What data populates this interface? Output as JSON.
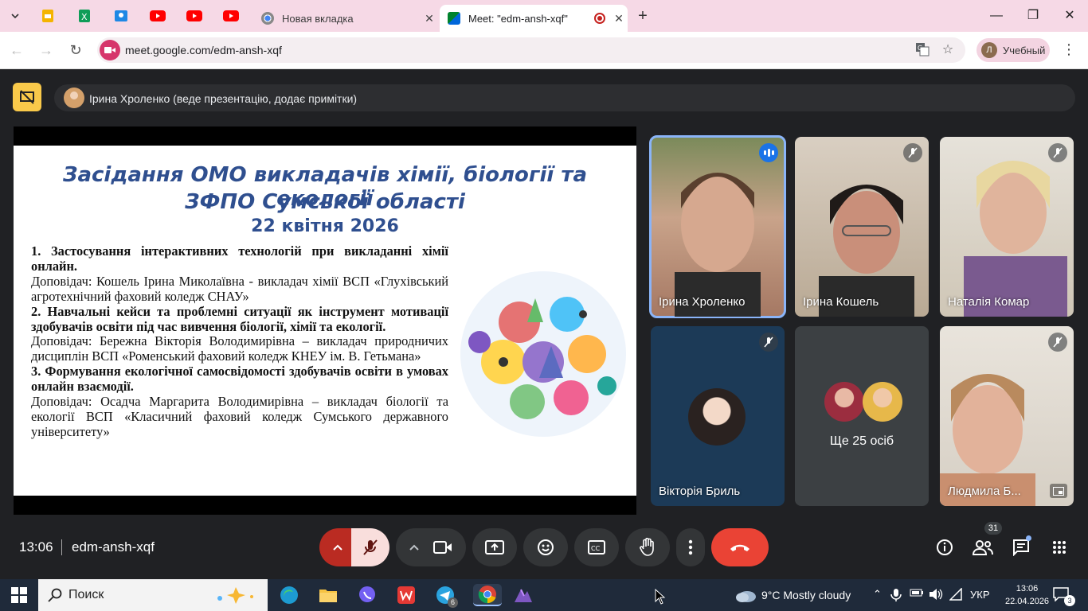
{
  "browser": {
    "tabs": [
      {
        "title": "Новая вкладка",
        "close": "✕"
      },
      {
        "title": "Meet: \"edm-ansh-xqf\"",
        "close": "✕"
      }
    ],
    "address": "meet.google.com/edm-ansh-xqf",
    "profile_initial": "Л",
    "profile_label": "Учебный"
  },
  "presenter_bar": {
    "text": "Ірина Хроленко (веде презентацію, додає примітки)"
  },
  "slide": {
    "title_line1": "Засідання ОМО викладачів хімії, біології та екології",
    "title_line2": "ЗФПО Сумської області",
    "date": "22 квітня 2026",
    "items": [
      {
        "heading": "1. Застосування інтерактивних технологій при викладанні хімії онлайн.",
        "speaker": "Доповідач: Кошель Ірина Миколаївна - викладач хімії ВСП «Глухівський агротехнічний фаховий коледж СНАУ»"
      },
      {
        "heading": "2. Навчальні кейси та проблемні ситуації як інструмент мотивації здобувачів освіти під час вивчення біології, хімії та екології.",
        "speaker": "Доповідач: Бережна Вікторія Володимирівна – викладач природничих дисциплін ВСП «Роменський фаховий коледж КНЕУ ім. В. Гетьмана»"
      },
      {
        "heading": "3. Формування екологічної самосвідомості здобувачів освіти в умовах онлайн взаємодії.",
        "speaker": "Доповідач: Осадча Маргарита Володимирівна – викладач біології та екології ВСП «Класичний фаховий коледж Сумського державного університету»"
      }
    ]
  },
  "participants": [
    {
      "name": "Ірина Хроленко",
      "state": "speaking"
    },
    {
      "name": "Ірина Кошель",
      "state": "muted"
    },
    {
      "name": "Наталія Комар",
      "state": "muted"
    },
    {
      "name": "Вікторія Бриль",
      "state": "muted"
    },
    {
      "name": "Ще 25 осіб",
      "state": "group"
    },
    {
      "name": "Людмила Б...",
      "state": "muted"
    }
  ],
  "meeting": {
    "time": "13:06",
    "code": "edm-ansh-xqf",
    "people_count": "31"
  },
  "taskbar": {
    "search_placeholder": "Поиск",
    "telegram_badge": "6",
    "weather": "9°C  Mostly cloudy",
    "lang": "УКР",
    "time": "13:06",
    "date": "22.04.2026",
    "notifications": "3"
  },
  "colors": {
    "tabstrip": "#f6d9e6",
    "meet_bg": "#202124",
    "end_call": "#ea4335",
    "slide_title": "#2f4f8f"
  }
}
